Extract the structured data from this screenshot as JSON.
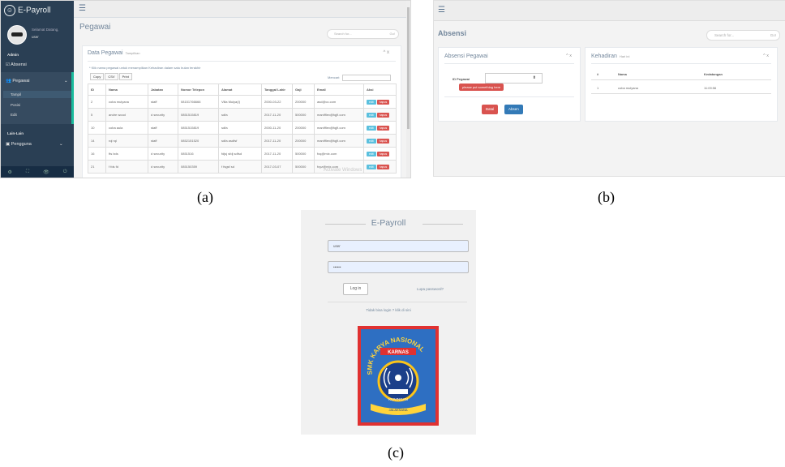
{
  "panel_a": {
    "brand": "E-Payroll",
    "brand_icon": "logo-icon",
    "welcome": "Selamat Datang,",
    "user": "user",
    "section_admin": "Admin",
    "menu": {
      "absensi": "Absensi",
      "pegawai": "Pegawai",
      "sub": [
        "Tampil",
        "Posisi",
        "Edit"
      ],
      "section_lain": "Lain-Lain",
      "pengguna": "Pengguna"
    },
    "page_title": "Pegawai",
    "search_placeholder": "Search for...",
    "search_go": "Go!",
    "card_title": "Data Pegawai",
    "card_subtitle": "Tampilkan",
    "card_tools": "^ x",
    "note": "* Klik nama pegawai untuk menampilkan Kehadiran dalam satu bulan terakhir",
    "export_buttons": [
      "Copy",
      "CSV",
      "Print"
    ],
    "filter_label": "Mencari:",
    "table": {
      "headers": [
        "ID",
        "Nama",
        "Jabatan",
        "Nomor Telepon",
        "Alamat",
        "Tanggal Lahir",
        "Gaji",
        "Email",
        "Aksi"
      ],
      "rows": [
        [
          "2",
          "coba mulyana",
          "staff",
          "08151766666",
          "Villa Mulya(I)",
          "2000-03-22",
          "200000",
          "asd@cc.com"
        ],
        [
          "5",
          "andre wood",
          "d security",
          "0851515819",
          "sdfa",
          "2017-11-20",
          "500000",
          "manifflex@fqjfi.com"
        ],
        [
          "10",
          "coba aula",
          "staff",
          "0851515819",
          "sdfa",
          "2000-11-20",
          "200000",
          "manifflex@fqjfi.com"
        ],
        [
          "14",
          "rql rql",
          "staff",
          "0852151520",
          "sdfa asdfsf",
          "2017-11-20",
          "200000",
          "manifflex@fqjfi.com"
        ],
        [
          "16",
          "fts bds",
          "d security",
          "0851516",
          "fdjsj sfdj sdfsd",
          "2017-11-20",
          "500000",
          "fxq@mix.com"
        ],
        [
          "21",
          "f fds fd",
          "d security",
          "085150359",
          "f fsgsf sd",
          "2017-03-07",
          "500000",
          "fxyz@mix.com"
        ]
      ],
      "edit_label": "edit",
      "delete_label": "hapus"
    },
    "watermark": "Activate Windows",
    "footer_icons": [
      "settings-icon",
      "fullscreen-icon",
      "lock-icon",
      "power-icon"
    ]
  },
  "panel_b": {
    "page_title": "Absensi",
    "search_placeholder": "Search for...",
    "search_go": "Go!",
    "card1": {
      "title": "Absensi Pegawai",
      "tools": "^ x",
      "field_label": "ID Pegawai",
      "field_arrow": "⬍",
      "tooltip": "please put something here",
      "batal": "Batal",
      "absen": "Absen"
    },
    "card2": {
      "title": "Kehadiran",
      "subtitle": "Hari ini",
      "tools": "^ x",
      "headers": [
        "#",
        "Nama",
        "Kedatangan"
      ],
      "row": [
        "1",
        "coba mulyana",
        "11:09:56"
      ]
    }
  },
  "panel_c": {
    "title": "E-Payroll",
    "username": "user",
    "password": "••••••",
    "login": "Log in",
    "lost": "Lupa password?",
    "register": "Tidak bisa login ? klik di sini",
    "logo_top": "SMK KARYA NASIONAL",
    "logo_badge": "KARNAS",
    "logo_bottom": "KUNINGAN",
    "logo_banner": "JALAKSANA"
  },
  "captions": [
    "(a)",
    "(b)",
    "(c)"
  ],
  "colors": {
    "sidebar": "#2a3f54",
    "accent": "#1abb9c",
    "edit": "#5bc0de",
    "delete": "#d9534f",
    "logo_bg": "#2e6fc2",
    "logo_border": "#e03131"
  }
}
